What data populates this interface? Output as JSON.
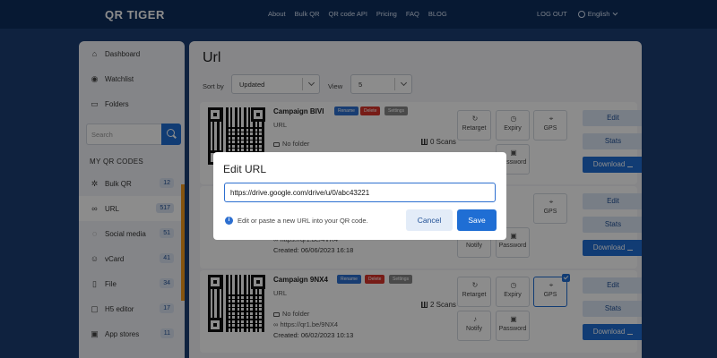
{
  "brand": {
    "logo_text": "QR TIGER"
  },
  "nav": {
    "links": [
      "About",
      "Bulk QR",
      "QR code API",
      "Pricing",
      "FAQ",
      "BLOG"
    ],
    "logout": "LOG OUT",
    "language": "English"
  },
  "sidebar": {
    "top_items": [
      {
        "label": "Dashboard",
        "icon": "home-icon"
      },
      {
        "label": "Watchlist",
        "icon": "eye-icon"
      },
      {
        "label": "Folders",
        "icon": "folder-icon"
      }
    ],
    "search_placeholder": "Search",
    "section_heading": "MY QR CODES",
    "codes": [
      {
        "label": "Bulk QR",
        "count": "12",
        "icon": "bulk-qr-icon"
      },
      {
        "label": "URL",
        "count": "517",
        "icon": "link-icon",
        "active": true
      },
      {
        "label": "Social media",
        "count": "51",
        "icon": "chat-icon"
      },
      {
        "label": "vCard",
        "count": "41",
        "icon": "person-icon"
      },
      {
        "label": "File",
        "count": "34",
        "icon": "file-icon"
      },
      {
        "label": "H5 editor",
        "count": "17",
        "icon": "h5-icon"
      },
      {
        "label": "App stores",
        "count": "11",
        "icon": "app-icon"
      }
    ]
  },
  "main": {
    "title": "Url",
    "sort_label": "Sort by",
    "sort_value": "Updated",
    "view_label": "View",
    "view_value": "5",
    "campaigns": [
      {
        "name": "Campaign BIVI",
        "type": "URL",
        "folder": "No folder",
        "link": "",
        "created": "",
        "scans": "0 Scans"
      },
      {
        "name": "",
        "type": "",
        "folder": "",
        "link": "https://qr1.be/4VR4",
        "created": "Created: 06/06/2023 16:18",
        "scans": ""
      },
      {
        "name": "Campaign 9NX4",
        "type": "URL",
        "folder": "No folder",
        "link": "https://qr1.be/9NX4",
        "created": "Created: 06/02/2023 10:13",
        "scans": "2 Scans"
      }
    ],
    "tags": {
      "rename": "Rename",
      "delete": "Delete",
      "settings": "Settings"
    },
    "actions": {
      "retarget": "Retarget",
      "expiry": "Expiry",
      "gps": "GPS",
      "notify": "Notify",
      "password": "Password"
    },
    "buttons": {
      "edit": "Edit",
      "stats": "Stats",
      "download": "Download"
    }
  },
  "modal": {
    "title": "Edit URL",
    "url_value": "https://drive.google.com/drive/u/0/abc43221",
    "hint": "Edit or paste a new URL into your QR code.",
    "cancel": "Cancel",
    "save": "Save"
  }
}
